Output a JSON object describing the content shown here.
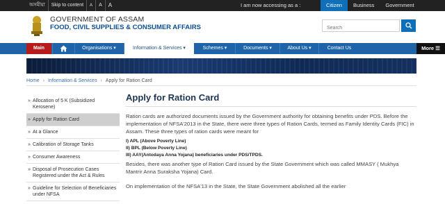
{
  "topbar": {
    "language": "অসমীয়া",
    "skip": "Skip to content",
    "font_small": "A",
    "font_normal": "A",
    "font_large": "A",
    "access_prompt": "I am now accessing as a :",
    "roles": [
      "Citizen",
      "Business",
      "Government"
    ]
  },
  "header": {
    "government": "GOVERNMENT OF ASSAM",
    "department": "FOOD, CIVIL SUPPLIES & CONSUMER AFFAIRS",
    "search_placeholder": "Search"
  },
  "nav": {
    "main": "Main",
    "items": [
      "Organisations ▾",
      "Information & Services ▾",
      "Schemes ▾",
      "Documents ▾",
      "About Us ▾",
      "Contact Us"
    ],
    "more": "More ☰"
  },
  "breadcrumb": [
    "Home",
    "Information & Services",
    "Apply for Ration Card"
  ],
  "sidebar": [
    "Allocation of 5 K (Subsidized Kerosene)",
    "Apply for Ration Card",
    "At a Glance",
    "Calibration of Storage Tanks",
    "Consumer Awareness",
    "Disposal of Prosecution Cases Registered under the Act & Rules",
    "Guideline for Selection of Beneficiaries under NFSA"
  ],
  "content": {
    "title": "Apply for Ration Card",
    "p1": "Ration cards are authorized documents issued by the Government authority for obtaining benefits under PDS. Before the implementation of NFSA'2013 in the State, there were three types of Ration Cards, termed as Family Identity Cards (FIC) in Assam. These three types of ration cards were meant for",
    "list": [
      "I) APL (Above Poverty Line)",
      "II) BPL (Below Poverty Line)",
      "III) AAY(Antodaya Anna Yojana) beneficiaries under PDS/TPDS."
    ],
    "p2": "Besides, there was another type of Ration Card issued by the State Government which was called MMASY ( Mukhya Mantrir Anna Suraksha Yojana) Card.",
    "p3": "On implementation of the NFSA'13 in the State, the State Government abolished all the earlier"
  }
}
